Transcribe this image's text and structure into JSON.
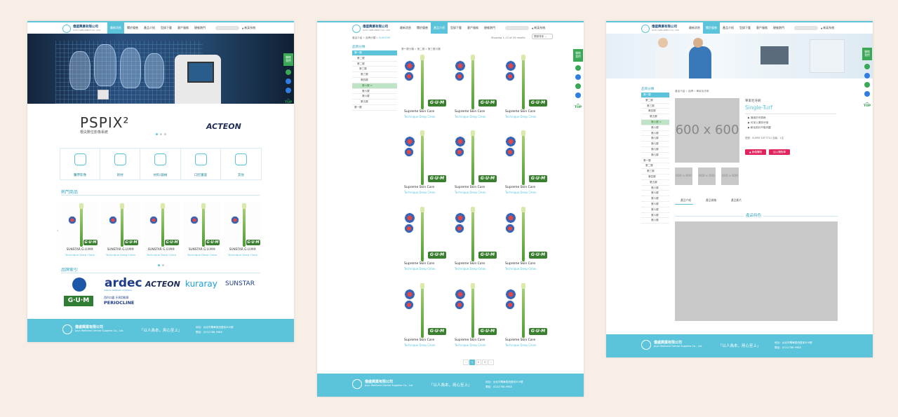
{
  "company": {
    "name": "億盛興業有限公司",
    "en": "GOYU WELLBEST CO., LTD."
  },
  "nav": [
    "最新消息",
    "關於優普",
    "產品介紹",
    "型錄下載",
    "客戶服務",
    "捷維熱門"
  ],
  "lang": "新英系統",
  "sidebar": {
    "contact": [
      "聯絡",
      "我們"
    ],
    "top": "TOP"
  },
  "home": {
    "hero_brand": "PSPIX²",
    "hero_sub": "根尖數位影像系統",
    "hero_partner": "ACTEON",
    "categories": [
      "醫學影像",
      "耗材",
      "材料/器械",
      "口腔護理",
      "其他"
    ],
    "hot_title": "熱門商品",
    "hot_products": [
      {
        "name": "SUNSTAR G.U.M®",
        "sub": "Technique Deep Clean"
      },
      {
        "name": "SUNSTAR G.U.M®",
        "sub": "Technique Deep Clean"
      },
      {
        "name": "SUNSTAR G.U.M®",
        "sub": "Technique Deep Clean"
      },
      {
        "name": "SUNSTAR G.U.M®",
        "sub": "Technique Deep Clean"
      },
      {
        "name": "SUNSTAR G.U.M®",
        "sub": "Technique Deep Clean"
      }
    ],
    "brand_title": "品牌索引",
    "brands": [
      "ardec",
      "ACTEON",
      "kuraray",
      "SUNSTAR",
      "G·U·M",
      "PERIOCLINE"
    ],
    "brand_sub": {
      "ardec": "natural aesthetic solutions",
      "perio": "西利口露 牙周用軟膏"
    }
  },
  "list": {
    "crumb": [
      "產品介紹",
      "品牌分類",
      "SUNSTAR"
    ],
    "results": "Showing 1–12 of 29 results",
    "sort": "預設排序",
    "tree_head": "品牌分類",
    "tree": [
      "第一層",
      "第二層",
      "第二層",
      "第三層",
      "第三層",
      "第四層",
      "第六層 >",
      "第六層",
      "第六層",
      "第五層",
      "第一層"
    ],
    "sub_crumb": [
      "第一層分類",
      "第二層",
      "第三層分類"
    ],
    "product": {
      "name": "Supreme Skin Care",
      "sub": "Technique Deep Clean"
    },
    "pages": [
      "‹",
      "1",
      "2",
      "3",
      "›"
    ]
  },
  "detail": {
    "crumb": [
      "產品介紹",
      "品牌",
      "單束毛牙刷"
    ],
    "title": "單束毛牙刷",
    "subtitle": "Single-Turf",
    "features": [
      "▶ 適用於牙周病",
      "▶ 可深入清潔牙縫",
      "▶ 軟毛設計不傷牙齦"
    ],
    "spec": "型號：SUPER SOFT-T01  包裝：1支",
    "tree_head": "品牌分類",
    "tree": [
      "第一層",
      "第二層",
      "第三層",
      "第四層",
      "第五層",
      "第六層 >",
      "第六層",
      "第六層",
      "第六層",
      "第六層",
      "第六層",
      "第六層",
      "第一層",
      "第二層",
      "第三層",
      "第四層",
      "第五層",
      "第六層",
      "第六層",
      "第六層",
      "第六層",
      "第六層",
      "第六層",
      "第六層"
    ],
    "main_img": "600 x 600",
    "thumbs": [
      "600 x 600",
      "600 x 600",
      "600 x 600"
    ],
    "btn_cart": "▲ 詢價購物",
    "btn_list": "加入購物車",
    "tabs": [
      "產品介紹",
      "產品規格",
      "產品影片"
    ],
    "section": "產品特色"
  },
  "footer": {
    "name": "億盛興業有限公司",
    "en": "Joyo Wellbest Dental Supplies Co., Ltd.",
    "slogan": "「以人為本，用心至上」",
    "addr": "地址：台北市萬華區西昌街300號",
    "tel": "電話：(02)2788-9988"
  },
  "colors": {
    "accent": "#5bc4da",
    "green": "#3aa855",
    "gum": "#3a7f2f",
    "btn_red": "#e0245e",
    "bg": "#f7efe6"
  }
}
